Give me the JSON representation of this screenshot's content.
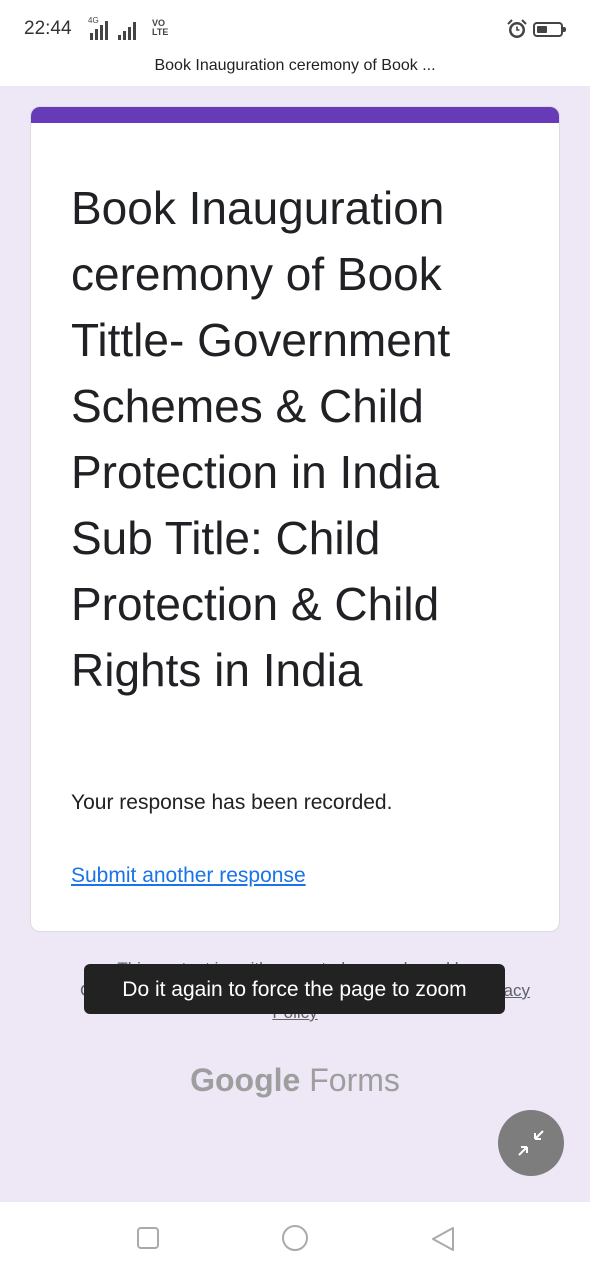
{
  "status_bar": {
    "time": "22:44",
    "network_label": "4G",
    "volte_line1": "VO",
    "volte_line2": "LTE",
    "icons": [
      "signal-icon",
      "alarm-icon",
      "battery-icon"
    ]
  },
  "page_title": "Book Inauguration ceremony of Book ...",
  "form": {
    "accent_color": "#673ab7",
    "title": "Book Inauguration ceremony of Book Tittle- Government Schemes & Child Protection in India Sub Title: Child Protection & Child Rights in India",
    "confirmation": "Your response has been recorded.",
    "submit_another": "Submit another response"
  },
  "footer": {
    "disclaimer_line1": "This content is neither created nor endorsed by",
    "disclaimer_line2_start": "Go",
    "disclaimer_line2_end": "acy",
    "disclaimer_line3": "Policy",
    "toast": "Do it again to force the page to zoom",
    "brand_google": "Google",
    "brand_forms": "Forms"
  },
  "nav": {
    "icons": [
      "recents-icon",
      "home-icon",
      "back-icon"
    ]
  }
}
